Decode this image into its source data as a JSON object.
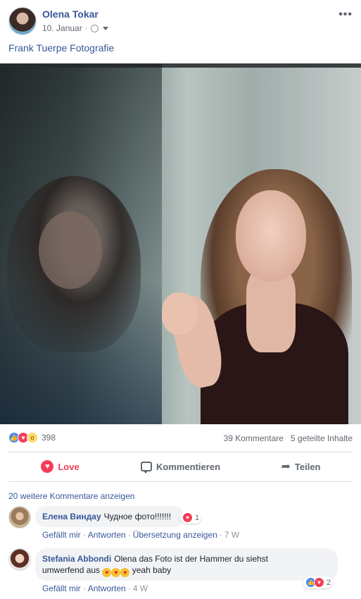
{
  "post": {
    "author": "Olena Tokar",
    "date": "10. Januar",
    "text": "Frank Tuerpe Fotografie",
    "more_icon": "•••"
  },
  "reactions": {
    "icons": [
      "like-icon",
      "love-icon",
      "wow-icon"
    ],
    "count": "398",
    "comments": "39 Kommentare",
    "shares": "5 geteilte Inhalte"
  },
  "actions": {
    "love": "Love",
    "comment": "Kommentieren",
    "share": "Teilen"
  },
  "comments": {
    "more": "20 weitere Kommentare anzeigen",
    "items": [
      {
        "name": "Елена Виндау",
        "text": "Чудное фото!!!!!!!",
        "reaction_count": "1",
        "like": "Gefällt mir",
        "reply": "Antworten",
        "translate": "Übersetzung anzeigen",
        "time": "7 W"
      },
      {
        "name": "Stefania Abbondi",
        "text_part1": "Olena das Foto ist der Hammer du siehst",
        "text_part2": "umwerfend aus",
        "text_part3": "yeah baby",
        "reaction_count": "2",
        "like": "Gefällt mir",
        "reply": "Antworten",
        "time": "4 W"
      }
    ]
  },
  "colors": {
    "link": "#385898",
    "love": "#f33e58",
    "like": "#4a8cf7",
    "muted": "#616770"
  }
}
